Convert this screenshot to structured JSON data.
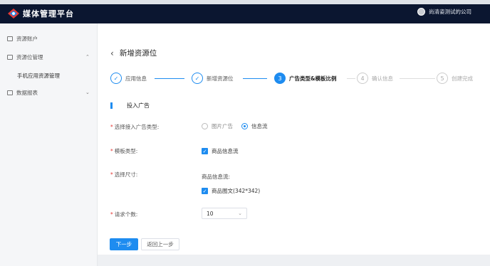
{
  "header": {
    "app_title": "媒体管理平台",
    "user_name": "尚清姿测试的公司"
  },
  "sidebar": {
    "items": [
      {
        "label": "资源账户",
        "icon": "account-icon"
      },
      {
        "label": "资源位管理",
        "icon": "grid-icon",
        "expanded": true
      },
      {
        "label": "数据报表",
        "icon": "report-icon",
        "expanded": false
      }
    ],
    "subitems": [
      "手机应用资源管理"
    ]
  },
  "page": {
    "title": "新增资源位"
  },
  "steps": [
    {
      "index": "✓",
      "label": "应用信息",
      "state": "done"
    },
    {
      "index": "✓",
      "label": "新增资源位",
      "state": "done"
    },
    {
      "index": "3",
      "label": "广告类型&模板比例",
      "state": "active"
    },
    {
      "index": "4",
      "label": "确认信息",
      "state": "future"
    },
    {
      "index": "5",
      "label": "创建完成",
      "state": "future"
    }
  ],
  "section": {
    "title": "投入广告"
  },
  "form": {
    "ad_type_label": "选择接入广告类型:",
    "ad_type_options": [
      "图片广告",
      "信息流"
    ],
    "ad_type_selected": "信息流",
    "template_label": "模板类型:",
    "template_value": "商品信息流",
    "size_label": "选择尺寸:",
    "size_group_label": "商品信息流:",
    "size_value": "商品图文(342*342)",
    "count_label": "请求个数:",
    "count_value": "10"
  },
  "buttons": {
    "next": "下一步",
    "back": "返回上一步"
  },
  "colors": {
    "header_bg": "#0b1630",
    "primary": "#1e8cf0"
  }
}
